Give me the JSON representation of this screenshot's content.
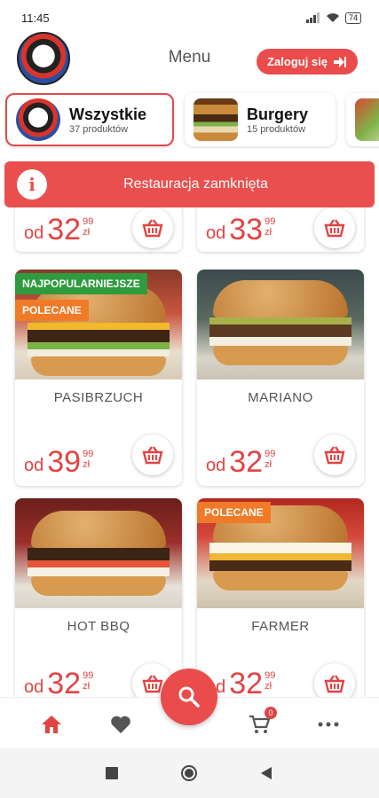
{
  "status_bar": {
    "time": "11:45",
    "battery": "74"
  },
  "header": {
    "title": "Menu",
    "login_label": "Zaloguj się"
  },
  "categories": [
    {
      "name": "Wszystkie",
      "count": "37 produktów",
      "active": true
    },
    {
      "name": "Burgery",
      "count": "15 produktów",
      "active": false
    }
  ],
  "alert": {
    "text": "Restauracja zamknięta"
  },
  "products": [
    {
      "name": "",
      "prefix": "od",
      "price_main": "32",
      "price_cents": "99",
      "currency": "zł"
    },
    {
      "name": "",
      "prefix": "od",
      "price_main": "33",
      "price_cents": "99",
      "currency": "zł"
    },
    {
      "name": "PASIBRZUCH",
      "prefix": "od",
      "price_main": "39",
      "price_cents": "99",
      "currency": "zł",
      "badges": [
        "NAJPOPULARNIEJSZE",
        "POLECANE"
      ]
    },
    {
      "name": "MARIANO",
      "prefix": "od",
      "price_main": "32",
      "price_cents": "99",
      "currency": "zł"
    },
    {
      "name": "HOT BBQ",
      "prefix": "od",
      "price_main": "32",
      "price_cents": "99",
      "currency": "zł"
    },
    {
      "name": "FARMER",
      "prefix": "od",
      "price_main": "32",
      "price_cents": "99",
      "currency": "zł",
      "badges": [
        "POLECANE"
      ]
    }
  ],
  "nav": {
    "cart_count": "0"
  },
  "icons": {
    "home": "home-icon",
    "favorites": "heart-icon",
    "search": "search-icon",
    "cart": "shopping-cart-icon",
    "more": "more-icon",
    "add_to_cart": "basket-icon",
    "info": "info-icon",
    "login": "login-icon"
  },
  "colors": {
    "accent": "#ea4b4b",
    "badge_green": "#2e9b3e",
    "badge_orange": "#f07a28"
  }
}
